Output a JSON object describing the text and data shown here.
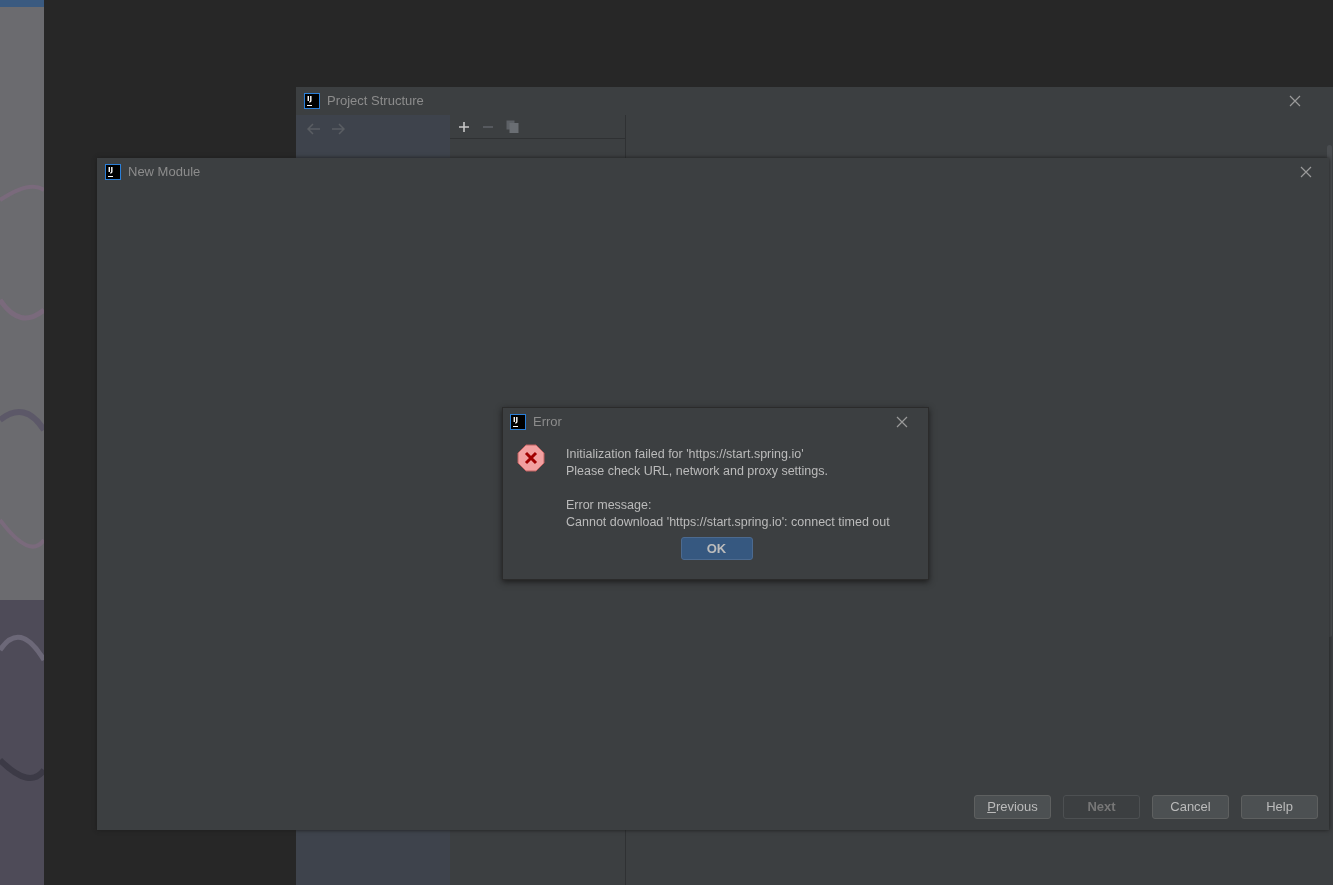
{
  "project_structure": {
    "icon_text": "IJ",
    "title": "Project Structure"
  },
  "new_module": {
    "icon_text": "IJ",
    "title": "New Module",
    "buttons": [
      {
        "label": "Previous",
        "disabled": false,
        "underline_first": true
      },
      {
        "label": "Next",
        "disabled": true,
        "underline_first": false
      },
      {
        "label": "Cancel",
        "disabled": false,
        "underline_first": false
      },
      {
        "label": "Help",
        "disabled": false,
        "underline_first": false
      }
    ]
  },
  "error_dialog": {
    "icon_text": "IJ",
    "title": "Error",
    "paragraphs": [
      [
        "Initialization failed for 'https://start.spring.io'",
        "Please check URL, network and proxy settings."
      ],
      [
        "Error message:",
        "Cannot download 'https://start.spring.io': connect timed out"
      ]
    ],
    "button": "OK"
  }
}
